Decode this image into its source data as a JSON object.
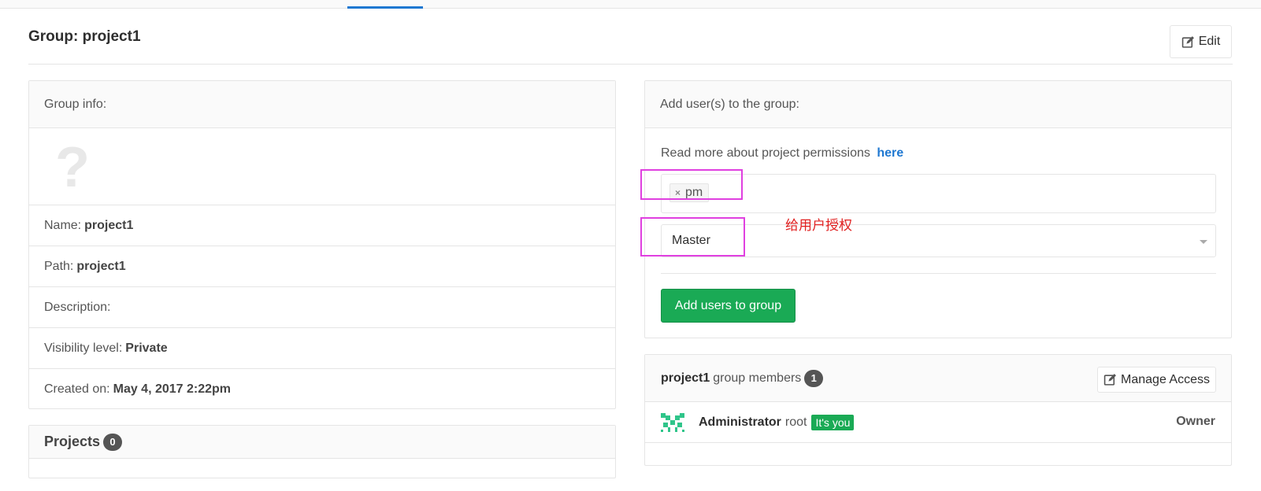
{
  "header": {
    "title": "Group: project1",
    "edit_label": "Edit"
  },
  "group_info": {
    "heading": "Group info:",
    "avatar_placeholder": "?",
    "rows": [
      {
        "label": "Name:",
        "value": "project1"
      },
      {
        "label": "Path:",
        "value": "project1"
      },
      {
        "label": "Description:",
        "value": ""
      },
      {
        "label": "Visibility level:",
        "value": "Private"
      },
      {
        "label": "Created on:",
        "value": "May 4, 2017 2:22pm"
      }
    ]
  },
  "projects": {
    "label": "Projects",
    "count": "0"
  },
  "add_users": {
    "heading": "Add user(s) to the group:",
    "read_more_text": "Read more about project permissions",
    "read_more_link": "here",
    "selected_users": [
      "pm"
    ],
    "token_remove": "×",
    "access_level": "Master",
    "submit_label": "Add users to group"
  },
  "members": {
    "group_name": "project1",
    "heading_suffix": "group members",
    "count": "1",
    "manage_label": "Manage Access",
    "list": [
      {
        "name": "Administrator",
        "username": "root",
        "badge": "It's you",
        "role": "Owner"
      }
    ]
  },
  "annotation": {
    "text": "给用户授权",
    "color": "#e02020",
    "box_color": "#e040e0"
  },
  "colors": {
    "accent": "#1f78d1",
    "success": "#1aaa55"
  }
}
